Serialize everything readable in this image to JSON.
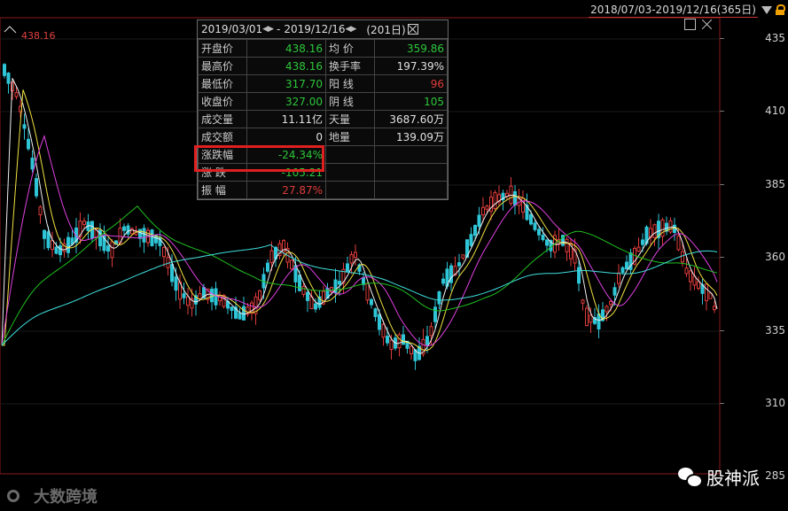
{
  "header": {
    "range_label": "2018/07/03-2019/12/16(365日)",
    "dropdown_icon": "triangle-down-icon",
    "lock_icon": "lock-icon"
  },
  "chart": {
    "high_marker": "438.16",
    "price_ticks": [
      "435",
      "410",
      "385",
      "360",
      "335",
      "310",
      "285"
    ]
  },
  "info_panel": {
    "start_date": "2019/03/01",
    "separator": "-",
    "end_date": "2019/12/16",
    "days": "(201日)",
    "rows": [
      {
        "l1": "开盘价",
        "v1": "438.16",
        "c1": "#2dc63a",
        "l2": "均 价",
        "v2": "359.86",
        "c2": "#2dc63a"
      },
      {
        "l1": "最高价",
        "v1": "438.16",
        "c1": "#2dc63a",
        "l2": "换手率",
        "v2": "197.39%",
        "c2": "#e0e0e0"
      },
      {
        "l1": "最低价",
        "v1": "317.70",
        "c1": "#2dc63a",
        "l2": "阳 线",
        "v2": "96",
        "c2": "#e03b3b"
      },
      {
        "l1": "收盘价",
        "v1": "327.00",
        "c1": "#2dc63a",
        "l2": "阴 线",
        "v2": "105",
        "c2": "#2dc63a"
      },
      {
        "l1": "成交量",
        "v1": "11.11亿",
        "c1": "#e0e0e0",
        "l2": "天量",
        "v2": "3687.60万",
        "c2": "#e0e0e0"
      },
      {
        "l1": "成交额",
        "v1": "0",
        "c1": "#e0e0e0",
        "l2": "地量",
        "v2": "139.09万",
        "c2": "#e0e0e0"
      },
      {
        "l1": "涨跌幅",
        "v1": "-24.34%",
        "c1": "#2dc63a",
        "l2": "",
        "v2": "",
        "c2": "#e0e0e0"
      },
      {
        "l1": "涨 跌",
        "v1": "-105.21",
        "c1": "#2dc63a",
        "l2": "",
        "v2": "",
        "c2": "#e0e0e0"
      },
      {
        "l1": "振 幅",
        "v1": "27.87%",
        "c1": "#e03b3b",
        "l2": "",
        "v2": "",
        "c2": "#e0e0e0"
      }
    ]
  },
  "watermarks": {
    "left": "大数跨境",
    "right": "股神派"
  },
  "colors": {
    "up": "#e03b3b",
    "down": "#2ec5d6",
    "ma5": "#f0f0f0",
    "ma10": "#f0e040",
    "ma20": "#e040e0",
    "ma60": "#20c020",
    "ma120": "#40e0e0"
  }
}
